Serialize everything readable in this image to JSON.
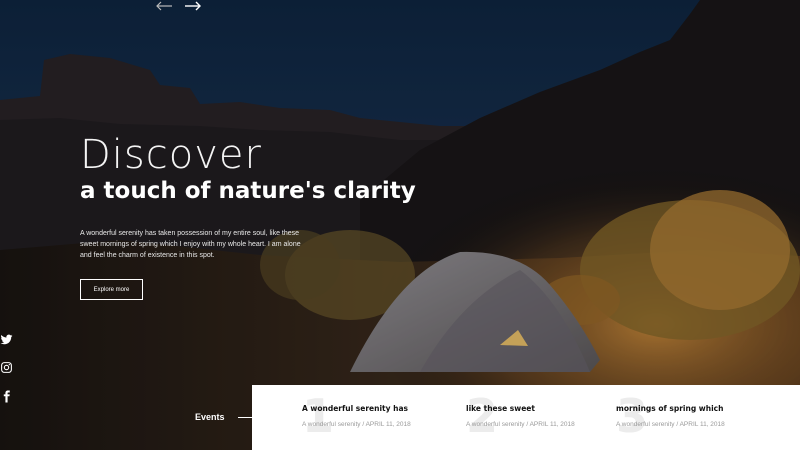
{
  "hero": {
    "title_light": "Discover",
    "title_bold": "a touch of nature's clarity",
    "description": "A wonderful serenity has taken possession of my entire soul, like these sweet mornings of spring which I enjoy with my whole heart. I am alone and feel the charm of existence in this spot.",
    "cta_label": "Explore more"
  },
  "social": {
    "icons": [
      "twitter-icon",
      "instagram-icon",
      "facebook-icon"
    ]
  },
  "events": {
    "label": "Events",
    "items": [
      {
        "number": "1",
        "title": "A wonderful serenity has",
        "meta": "A wonderful serenity / APRIL 11, 2018"
      },
      {
        "number": "2",
        "title": "like these sweet",
        "meta": "A wonderful serenity / APRIL 11, 2018"
      },
      {
        "number": "3",
        "title": "mornings of spring which",
        "meta": "A wonderful serenity / APRIL 11, 2018"
      }
    ]
  },
  "colors": {
    "sky": "#13253d",
    "cliffs": "#1c1a1e",
    "tent": "#7f7c82",
    "glow": "#c98a3c",
    "panel": "#ffffff"
  }
}
